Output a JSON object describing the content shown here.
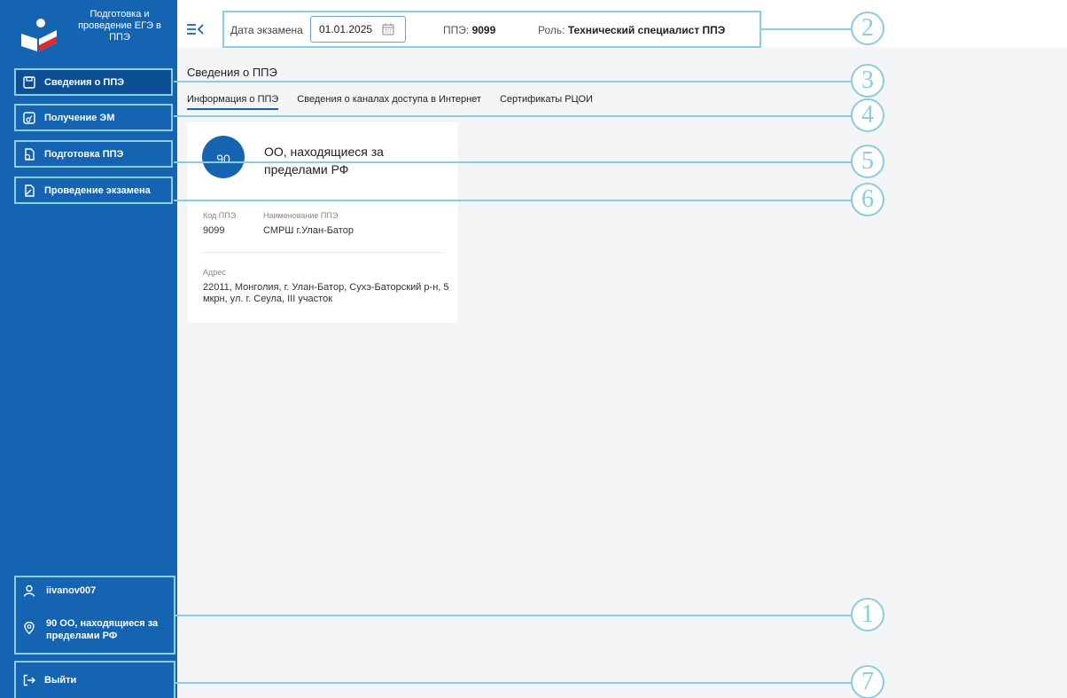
{
  "app": {
    "logo_text": "Подготовка и проведение ЕГЭ в ППЭ"
  },
  "sidebar": {
    "items": [
      {
        "label": "Сведения о ППЭ",
        "icon": "save-icon"
      },
      {
        "label": "Получение ЭМ",
        "icon": "document-key-icon"
      },
      {
        "label": "Подготовка ППЭ",
        "icon": "document-settings-icon"
      },
      {
        "label": "Проведение экзамена",
        "icon": "document-pen-icon"
      }
    ],
    "user": {
      "login": "iivanov007",
      "location": "90 ОО, находящиеся за пределами РФ"
    },
    "logout_label": "Выйти"
  },
  "topbar": {
    "date_label": "Дата экзамена",
    "date_value": "01.01.2025",
    "pps_label": "ППЭ:",
    "pps_value": "9099",
    "role_label": "Роль:",
    "role_value": "Технический специалист ППЭ"
  },
  "main": {
    "page_title": "Сведения о ППЭ",
    "tabs": [
      {
        "label": "Информация о ППЭ",
        "active": true
      },
      {
        "label": "Сведения о каналах доступа в Интернет",
        "active": false
      },
      {
        "label": "Сертификаты РЦОИ",
        "active": false
      }
    ],
    "card": {
      "badge": "90",
      "title": "ОО, находящиеся за пределами РФ",
      "code_label": "Код ППЭ",
      "code_value": "9099",
      "name_label": "Наименование ППЭ",
      "name_value": "СМРШ г.Улан-Батор",
      "address_label": "Адрес",
      "address_value": "22011, Монголия, г. Улан-Батор, Сухэ-Баторский р-н, 5 мкрн, ул. г. Сеула, III участок"
    }
  },
  "callouts": [
    "1",
    "2",
    "3",
    "4",
    "5",
    "6",
    "7"
  ],
  "colors": {
    "sidebar": "#1464b1",
    "callout": "#8ccbe0",
    "accent": "#1464b1"
  }
}
